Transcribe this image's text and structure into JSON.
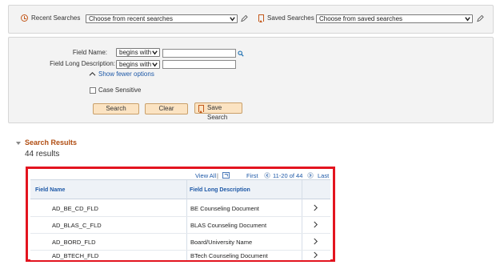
{
  "search_bar": {
    "recent_label": "Recent Searches",
    "recent_selected": "Choose from recent searches",
    "saved_label": "Saved Searches",
    "saved_selected": "Choose from saved searches"
  },
  "criteria": {
    "field_name_label": "Field Name:",
    "field_name_operator": "begins with",
    "field_name_value": "",
    "field_long_desc_label": "Field Long Description:",
    "field_long_desc_operator": "begins with",
    "field_long_desc_value": "",
    "show_fewer_label": "Show fewer options",
    "case_sensitive_label": "Case Sensitive",
    "case_sensitive_checked": false,
    "search_button": "Search",
    "clear_button": "Clear",
    "save_search_button": "Save Search"
  },
  "results": {
    "header": "Search Results",
    "count_text": "44 results",
    "nav": {
      "view_all": "View All",
      "separator": "|",
      "first": "First",
      "range": "11-20 of 44",
      "last": "Last"
    },
    "columns": [
      "Field Name",
      "Field Long Description"
    ],
    "rows": [
      {
        "field_name": "AD_BE_CD_FLD",
        "description": "BE Counseling Document"
      },
      {
        "field_name": "AD_BLAS_C_FLD",
        "description": "BLAS Counseling Document"
      },
      {
        "field_name": "AD_BORD_FLD",
        "description": "Board/University Name"
      },
      {
        "field_name": "AD_BTECH_FLD",
        "description": "BTech Counseling Document"
      }
    ]
  },
  "colors": {
    "accent_orange": "#c3581b",
    "link_blue": "#1d58a7",
    "highlight_red": "#e3141f",
    "button_fill": "#fbe3c2"
  }
}
